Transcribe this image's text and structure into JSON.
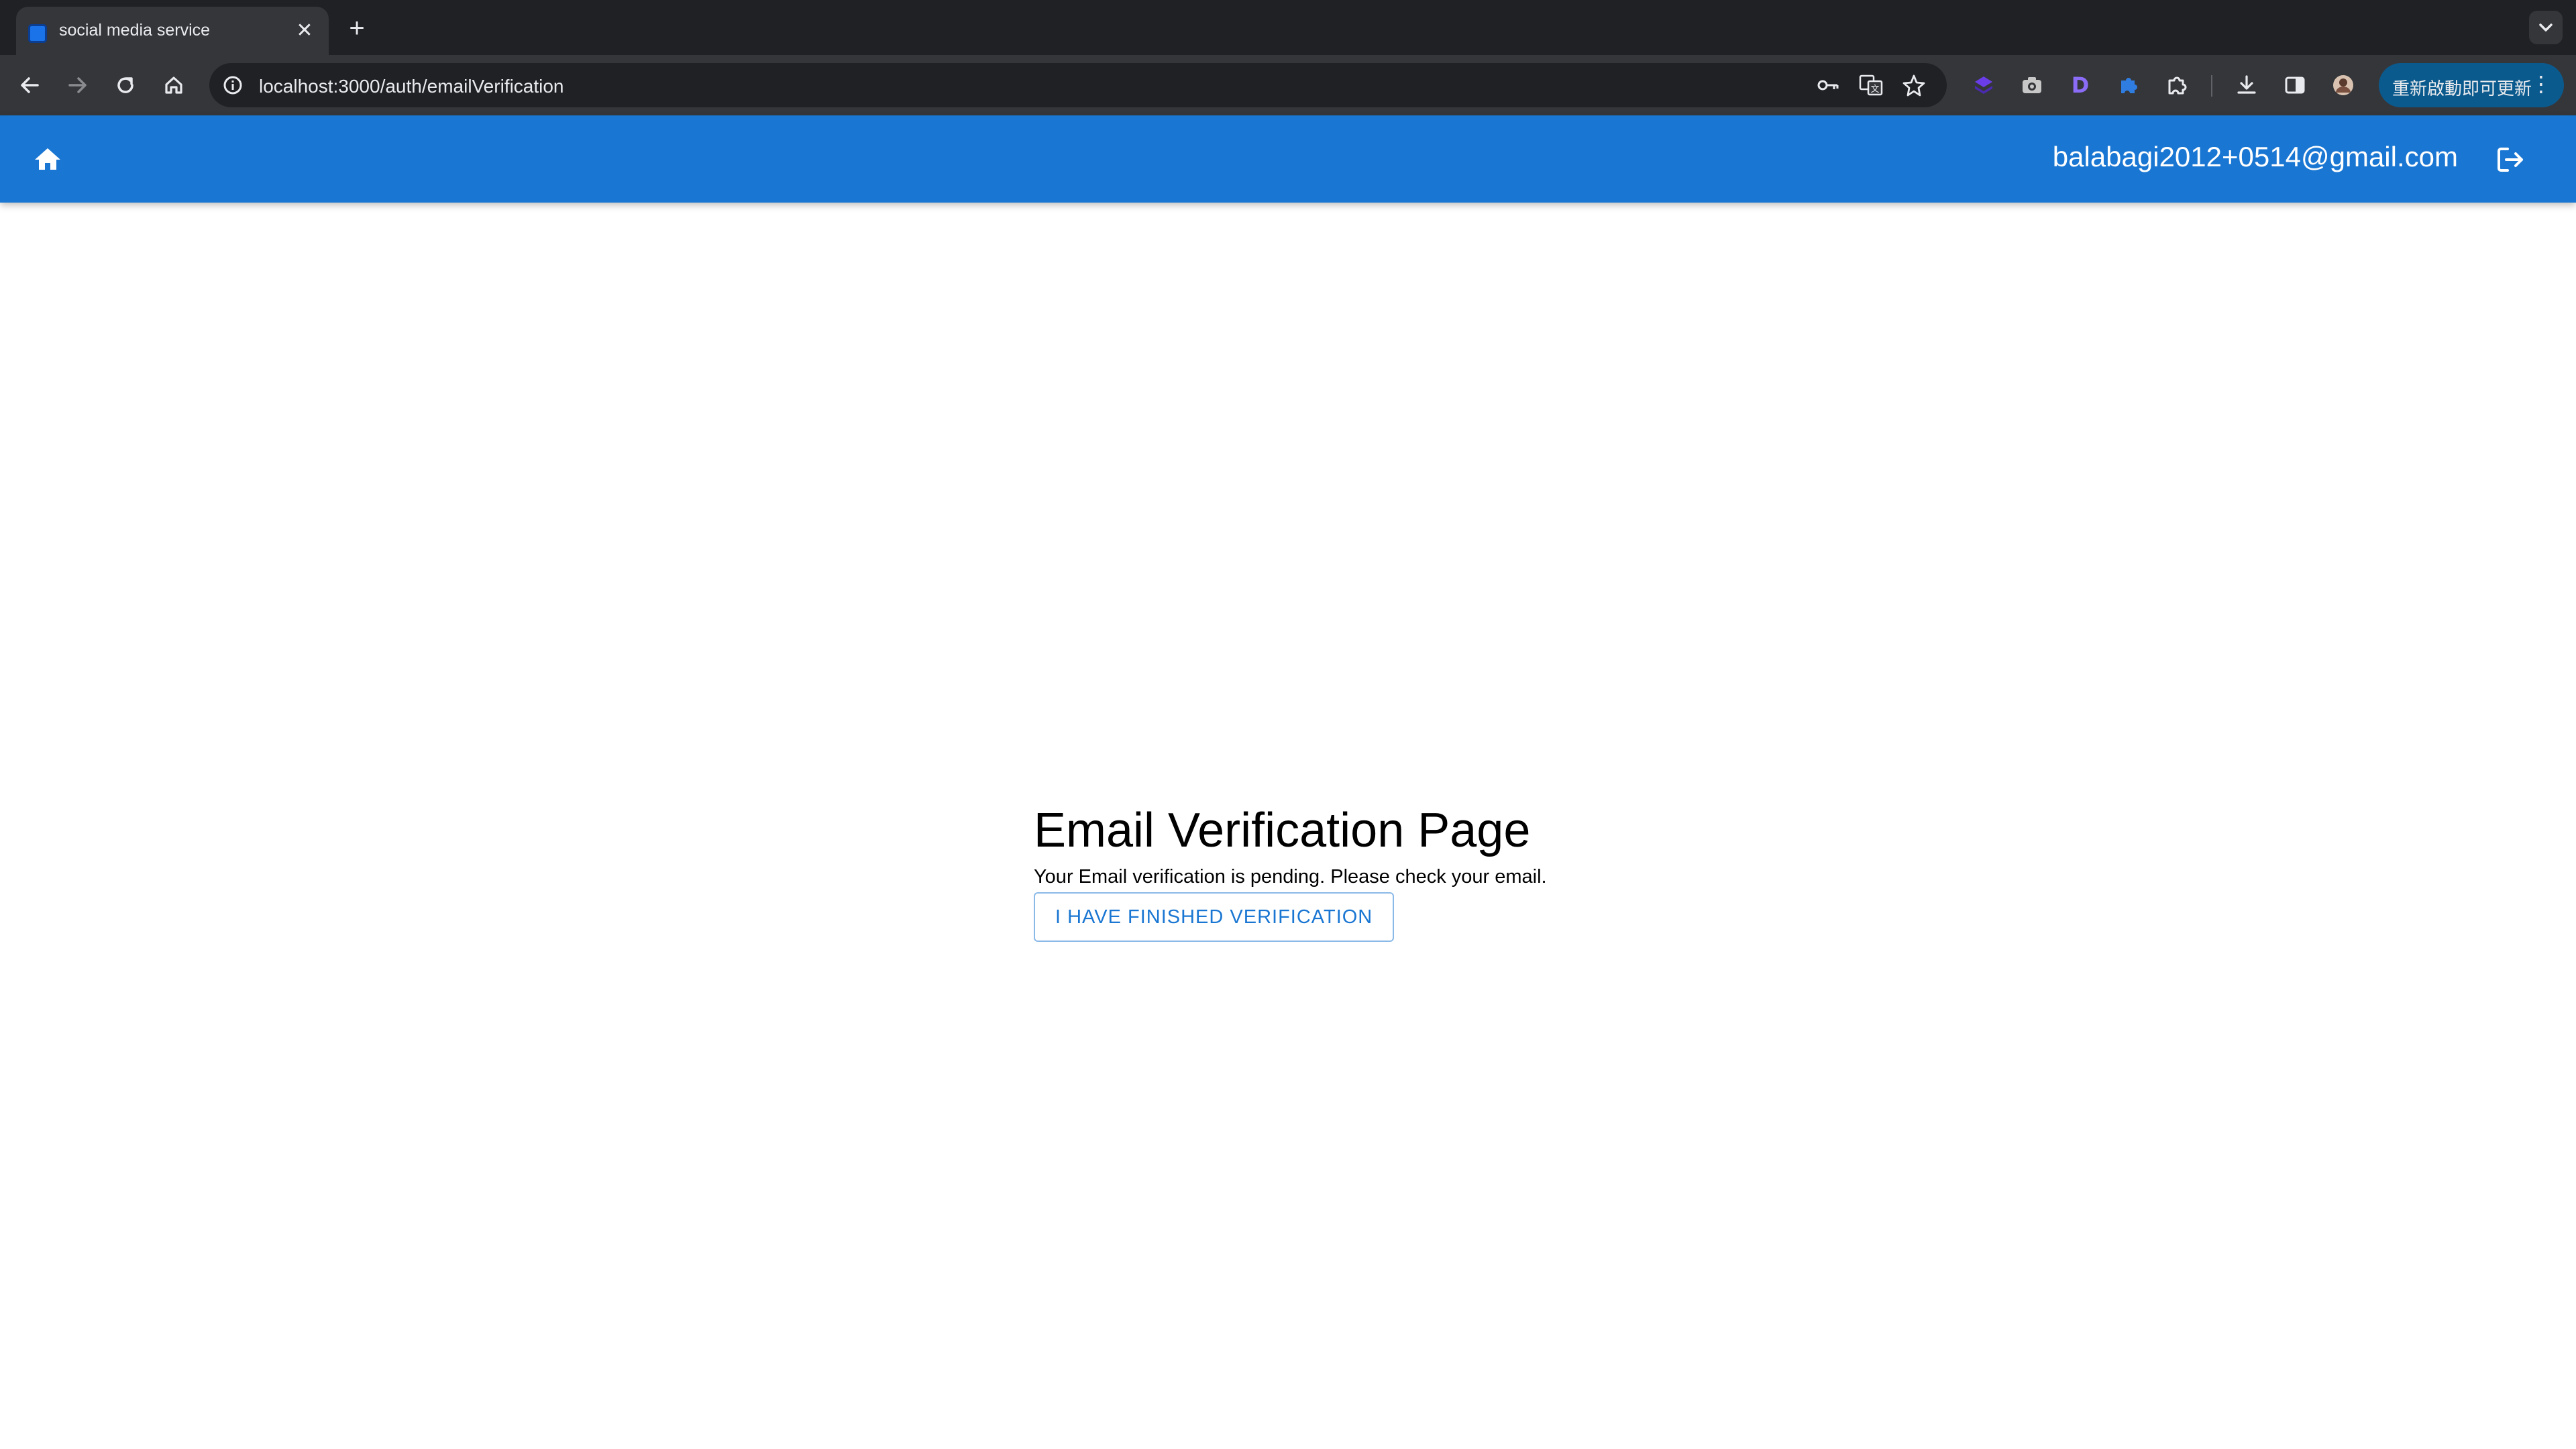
{
  "browser": {
    "tab": {
      "title": "social media service",
      "favicon": "app-favicon-icon"
    },
    "new_tab_icon": "plus-icon",
    "address": {
      "url": "localhost:3000/auth/emailVerification"
    },
    "update_button": {
      "label": "重新啟動即可更新"
    }
  },
  "appbar": {
    "home_icon": "home-icon",
    "user_email": "balabagi2012+0514@gmail.com",
    "logout_icon": "logout-icon",
    "color": "#1976d2"
  },
  "main": {
    "title": "Email Verification Page",
    "message": "Your Email verification is pending. Please check your email.",
    "button_label": "I HAVE FINISHED VERIFICATION"
  }
}
